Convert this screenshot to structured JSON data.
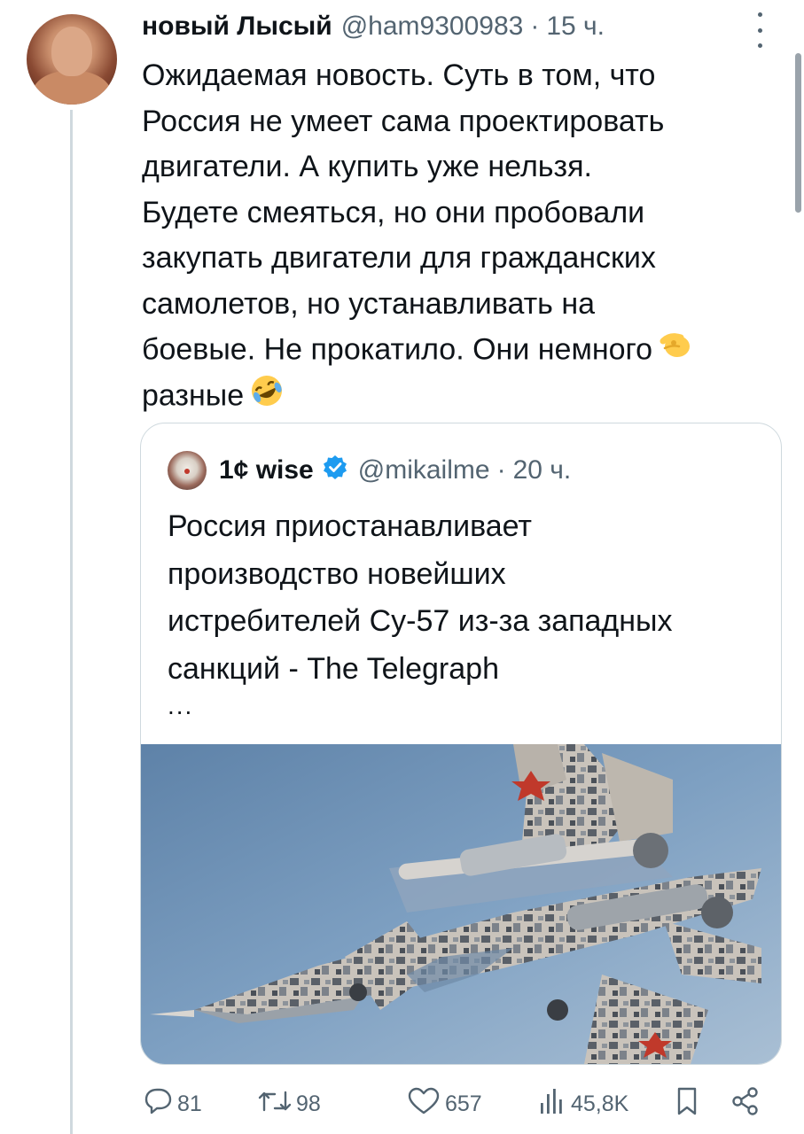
{
  "tweet": {
    "author_name": "новый Лысый",
    "handle": "@ham9300983",
    "separator": "·",
    "time": "15 ч.",
    "lines": [
      "Ожидаемая новость. Суть в том, что",
      "Россия не умеет сама проектировать",
      "двигатели. А купить уже нельзя.",
      "Будете смеяться, но они пробовали",
      "закупать двигатели для гражданских",
      "самолетов, но устанавливать на",
      "боевые. Не прокатило. Они немного",
      "разные"
    ],
    "emoji_1": "pinching-hand-emoji",
    "emoji_2": "rolling-on-floor-laughing-emoji"
  },
  "quoted": {
    "author_name": "1¢ wise",
    "verified": true,
    "handle": "@mikailme",
    "separator": "·",
    "time": "20 ч.",
    "lines": [
      "Россия приостанавливает",
      "производство новейших",
      "истребителей Су-57 из-за западных",
      "санкций - The Telegraph"
    ],
    "ellipsis": "...",
    "media": "su-57-fighter-jet-photo"
  },
  "actions": {
    "replies": "81",
    "retweets": "98",
    "likes": "657",
    "views": "45,8K"
  },
  "colors": {
    "text": "#0f1419",
    "secondary": "#536471",
    "border": "#cfd9de",
    "verified": "#1d9bf0",
    "sky": "#6f93b8"
  }
}
